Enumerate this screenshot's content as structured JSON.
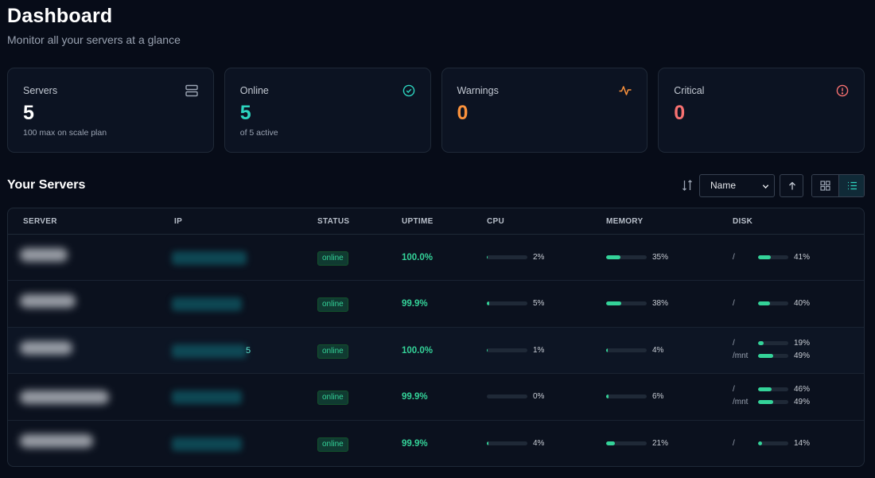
{
  "header": {
    "title": "Dashboard",
    "subtitle": "Monitor all your servers at a glance"
  },
  "cards": [
    {
      "label": "Servers",
      "value": "5",
      "sub": "100 max on scale plan",
      "icon": "server-icon",
      "color": "#ffffff"
    },
    {
      "label": "Online",
      "value": "5",
      "sub": "of 5 active",
      "icon": "check-circle-icon",
      "color": "#2dd4bf"
    },
    {
      "label": "Warnings",
      "value": "0",
      "sub": "",
      "icon": "activity-icon",
      "color": "#fb923c"
    },
    {
      "label": "Critical",
      "value": "0",
      "sub": "",
      "icon": "alert-circle-icon",
      "color": "#f87171"
    }
  ],
  "servers_section": {
    "title": "Your Servers",
    "sort_value": "Name",
    "sort_direction": "ascending"
  },
  "table": {
    "columns": [
      "SERVER",
      "IP",
      "STATUS",
      "UPTIME",
      "CPU",
      "MEMORY",
      "DISK"
    ],
    "rows": [
      {
        "status": "online",
        "uptime": "100.0%",
        "cpu": 2,
        "cpu_label": "2%",
        "memory": 35,
        "memory_label": "35%",
        "disks": [
          {
            "mount": "/",
            "pct": 41,
            "label": "41%"
          }
        ]
      },
      {
        "status": "online",
        "uptime": "99.9%",
        "cpu": 5,
        "cpu_label": "5%",
        "memory": 38,
        "memory_label": "38%",
        "disks": [
          {
            "mount": "/",
            "pct": 40,
            "label": "40%"
          }
        ]
      },
      {
        "status": "online",
        "uptime": "100.0%",
        "cpu": 1,
        "cpu_label": "1%",
        "memory": 4,
        "memory_label": "4%",
        "ip_tail": "5",
        "disks": [
          {
            "mount": "/",
            "pct": 19,
            "label": "19%"
          },
          {
            "mount": "/mnt",
            "pct": 49,
            "label": "49%"
          }
        ]
      },
      {
        "status": "online",
        "uptime": "99.9%",
        "cpu": 0,
        "cpu_label": "0%",
        "memory": 6,
        "memory_label": "6%",
        "disks": [
          {
            "mount": "/",
            "pct": 46,
            "label": "46%"
          },
          {
            "mount": "/mnt",
            "pct": 49,
            "label": "49%"
          }
        ]
      },
      {
        "status": "online",
        "uptime": "99.9%",
        "cpu": 4,
        "cpu_label": "4%",
        "memory": 21,
        "memory_label": "21%",
        "disks": [
          {
            "mount": "/",
            "pct": 14,
            "label": "14%"
          }
        ]
      }
    ]
  },
  "colors": {
    "background": "#070c18",
    "accent": "#34d399",
    "warning": "#fb923c",
    "critical": "#f87171"
  }
}
